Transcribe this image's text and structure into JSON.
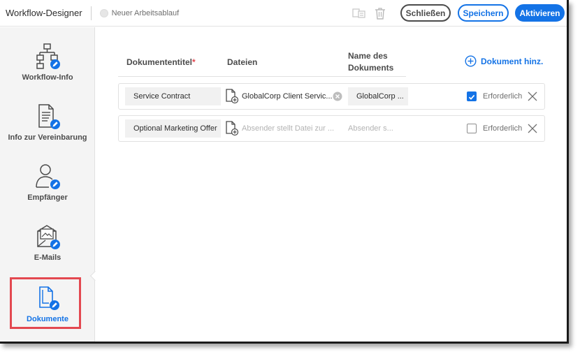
{
  "header": {
    "app_title": "Workflow-Designer",
    "workflow_name": "Neuer Arbeitsablauf",
    "close_label": "Schließen",
    "save_label": "Speichern",
    "activate_label": "Aktivieren"
  },
  "sidebar": {
    "items": [
      {
        "label": "Workflow-Info",
        "icon": "workflow-info-icon"
      },
      {
        "label": "Info zur Vereinbarung",
        "icon": "agreement-info-icon"
      },
      {
        "label": "Empfänger",
        "icon": "recipients-icon"
      },
      {
        "label": "E-Mails",
        "icon": "emails-icon"
      },
      {
        "label": "Dokumente",
        "icon": "documents-icon",
        "active": true
      }
    ]
  },
  "documents": {
    "col_title": "Dokumententitel",
    "col_title_required": "*",
    "col_files": "Dateien",
    "col_name_line1": "Name des",
    "col_name_line2": "Dokuments",
    "add_label": "Dokument hinz.",
    "rows": [
      {
        "title": "Service Contract",
        "file": "GlobalCorp Client Servic...",
        "file_placeholder": "",
        "name": "GlobalCorp ...",
        "name_placeholder": "",
        "required": true,
        "required_label": "Erforderlich"
      },
      {
        "title": "Optional Marketing Offer",
        "file": "",
        "file_placeholder": "Absender stellt Datei zur ...",
        "name": "",
        "name_placeholder": "Absender s...",
        "required": false,
        "required_label": "Erforderlich"
      }
    ]
  },
  "colors": {
    "accent": "#1473e6",
    "highlight_border": "#e34850",
    "sidebar_bg": "#f4f4f4"
  }
}
